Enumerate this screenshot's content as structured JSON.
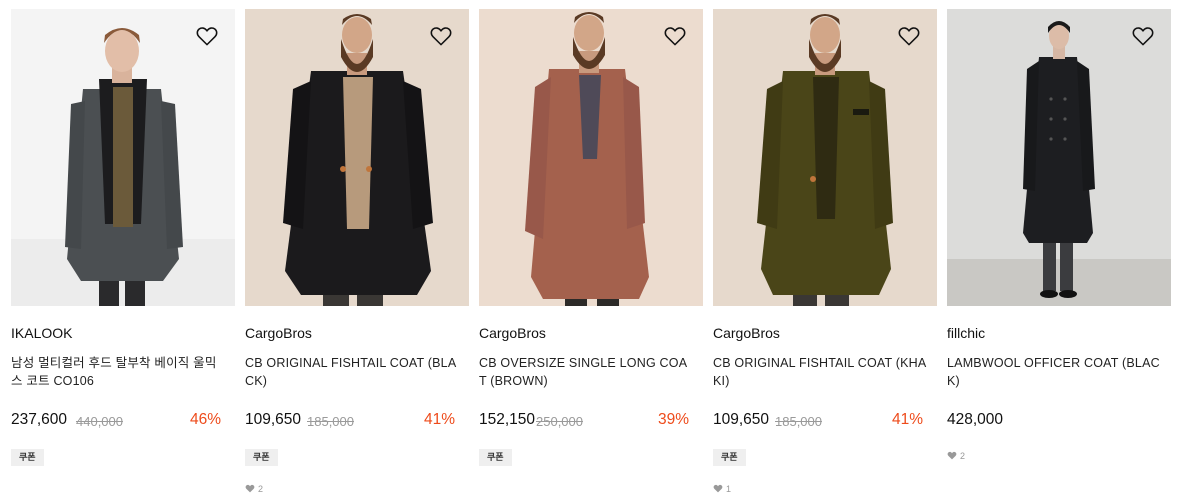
{
  "colors": {
    "discount": "#ee4b1b",
    "strike": "#9a9a9a",
    "coupon_bg": "#efefef"
  },
  "products": [
    {
      "brand": "IKALOOK",
      "name": "남성 멀티컬러 후드 탈부착 베이직 울믹스 코트 CO106",
      "price": "237,600",
      "original_price": "440,000",
      "discount": "46%",
      "coupon": "쿠폰",
      "likes": "",
      "image": "model in grey wool coat with black hood on white background",
      "coat_color": "#4b4f52"
    },
    {
      "brand": "CargoBros",
      "name": "CB ORIGINAL FISHTAIL COAT (BLACK)",
      "price": "109,650",
      "original_price": "185,000",
      "discount": "41%",
      "coupon": "쿠폰",
      "likes": "2",
      "image": "bearded model in black fishtail coat on beige background",
      "coat_color": "#1b1a1c"
    },
    {
      "brand": "CargoBros",
      "name": "CB OVERSIZE SINGLE LONG COAT (BROWN)",
      "price": "152,150",
      "original_price": "250,000",
      "discount": "39%",
      "coupon": "쿠폰",
      "likes": "",
      "image": "bearded model in brown oversized long coat on beige background",
      "coat_color": "#a4614d"
    },
    {
      "brand": "CargoBros",
      "name": "CB ORIGINAL FISHTAIL COAT (KHAKI)",
      "price": "109,650",
      "original_price": "185,000",
      "discount": "41%",
      "coupon": "쿠폰",
      "likes": "1",
      "image": "bearded model in khaki fishtail coat on beige background",
      "coat_color": "#4a4518"
    },
    {
      "brand": "fillchic",
      "name": "LAMBWOOL OFFICER COAT (BLACK)",
      "price": "428,000",
      "original_price": "",
      "discount": "",
      "coupon": "",
      "likes": "2",
      "image": "model in black double-breasted officer coat in concrete studio",
      "coat_color": "#1d1e21"
    }
  ]
}
